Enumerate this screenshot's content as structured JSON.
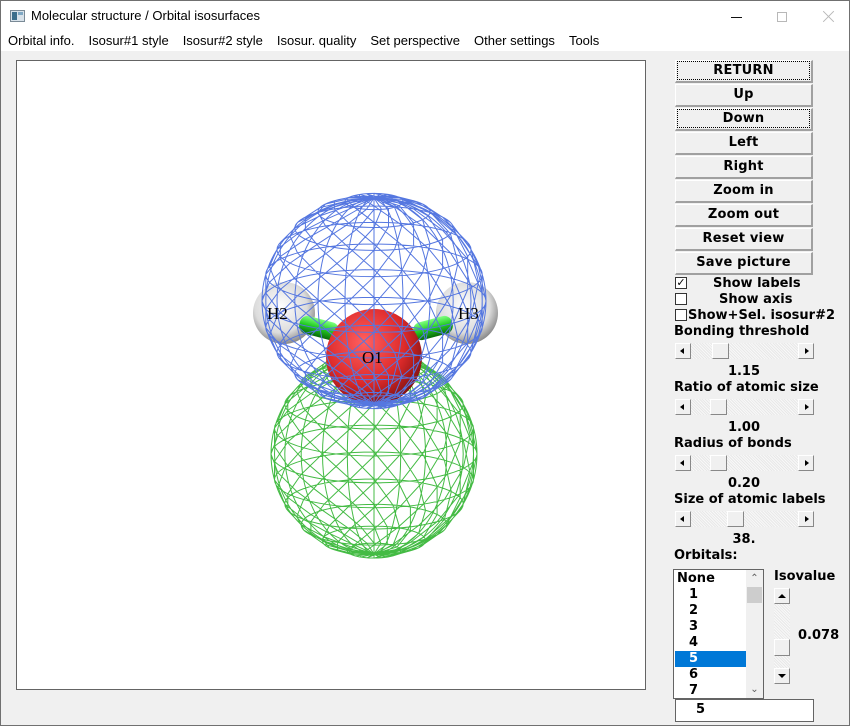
{
  "window": {
    "title": "Molecular structure / Orbital isosurfaces",
    "controls": [
      "minimize",
      "maximize",
      "close"
    ]
  },
  "menubar": {
    "items": [
      "Orbital info.",
      "Isosur#1 style",
      "Isosur#2 style",
      "Isosur. quality",
      "Set perspective",
      "Other settings",
      "Tools"
    ]
  },
  "viewport": {
    "atoms": [
      {
        "label": "O1",
        "element": "O",
        "color": "#e03030"
      },
      {
        "label": "H2",
        "element": "H",
        "color": "#e8e8e8"
      },
      {
        "label": "H3",
        "element": "H",
        "color": "#e8e8e8"
      }
    ],
    "bond_color": "#22cc22",
    "isosurface_positive_color": "#5577e0",
    "isosurface_negative_color": "#44bb44",
    "render_style": "wireframe"
  },
  "panel": {
    "buttons": [
      {
        "label": "RETURN",
        "focused": true
      },
      {
        "label": "Up",
        "focused": false
      },
      {
        "label": "Down",
        "focused": true
      },
      {
        "label": "Left",
        "focused": false
      },
      {
        "label": "Right",
        "focused": false
      },
      {
        "label": "Zoom in",
        "focused": false
      },
      {
        "label": "Zoom out",
        "focused": false
      },
      {
        "label": "Reset view",
        "focused": false
      },
      {
        "label": "Save picture",
        "focused": false
      }
    ],
    "checkboxes": [
      {
        "label": "Show labels",
        "checked": true
      },
      {
        "label": "Show axis",
        "checked": false
      },
      {
        "label": "Show+Sel. isosur#2",
        "checked": false
      }
    ],
    "sliders": [
      {
        "label": "Bonding threshold",
        "value": "1.15",
        "position": 0.2
      },
      {
        "label": "Ratio of atomic size",
        "value": "1.00",
        "position": 0.18
      },
      {
        "label": "Radius of bonds",
        "value": "0.20",
        "position": 0.18
      },
      {
        "label": "Size of atomic labels",
        "value": "38.",
        "position": 0.38
      }
    ],
    "orbitals": {
      "label": "Orbitals:",
      "items": [
        "None",
        "1",
        "2",
        "3",
        "4",
        "5",
        "6",
        "7"
      ],
      "selected": "5",
      "scroll_up_icon": "^",
      "scroll_down_icon": "v"
    },
    "isovalue": {
      "label": "Isovalue",
      "value": "0.078"
    },
    "selected_orbital_input": "5"
  }
}
